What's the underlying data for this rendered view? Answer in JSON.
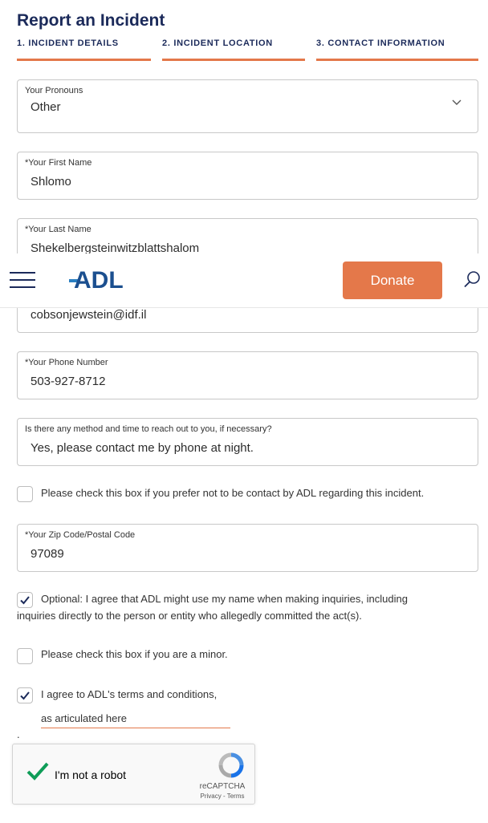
{
  "page": {
    "title": "Report an Incident",
    "steps": [
      "1. INCIDENT DETAILS",
      "2. INCIDENT LOCATION",
      "3. CONTACT INFORMATION"
    ]
  },
  "colors": {
    "accent": "#e4784a",
    "navy": "#1b2a5a",
    "check": "#1b2a5a"
  },
  "fields": {
    "pronouns": {
      "label": "Your Pronouns",
      "value": "Other"
    },
    "first_name": {
      "label": "*Your First Name",
      "value": "Shlomo"
    },
    "last_name": {
      "label": "*Your Last Name",
      "value": "Shekelbergsteinwitzblattshalom"
    },
    "email": {
      "value": "cobsonjewstein@idf.il"
    },
    "phone": {
      "label": "*Your Phone Number",
      "value": "503-927-8712"
    },
    "contact_method": {
      "label": "Is there any method and time to reach out to you, if necessary?",
      "value": "Yes, please contact me by phone at night."
    },
    "zip": {
      "label": "*Your Zip Code/Postal Code",
      "value": "97089"
    }
  },
  "checkboxes": {
    "no_contact": {
      "label": "Please check this box if you prefer not to be contact by ADL regarding this incident.",
      "checked": false
    },
    "use_name": {
      "label_line1": "Optional: I agree that ADL might use my name when making inquiries, including",
      "label_line2": "inquiries directly to the person or entity who allegedly committed the act(s).",
      "checked": true
    },
    "minor": {
      "label": "Please check this box if you are a minor.",
      "checked": false
    },
    "terms": {
      "label": "I agree to ADL's terms and conditions,",
      "link": "as articulated here",
      "suffix": ".",
      "checked": true
    }
  },
  "header": {
    "logo": "ADL",
    "donate_label": "Donate",
    "menu_icon": "hamburger-icon",
    "search_icon": "search-icon"
  },
  "captcha": {
    "label": "I'm not a robot",
    "brand": "reCAPTCHA",
    "links": "Privacy - Terms",
    "checked": true
  }
}
